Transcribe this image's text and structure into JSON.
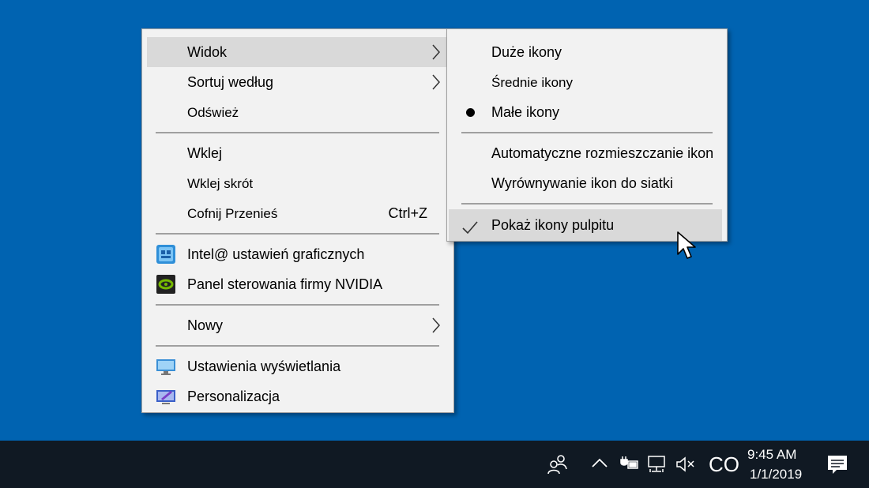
{
  "main_menu": {
    "items": [
      {
        "label": "Widok",
        "has_submenu": true,
        "highlighted": true
      },
      {
        "label": "Sortuj według",
        "has_submenu": true
      },
      {
        "label": "Odśwież"
      },
      {
        "label": "Wklej"
      },
      {
        "label": "Wklej skrót"
      },
      {
        "label": "Cofnij Przenieś",
        "shortcut": "Ctrl+Z"
      },
      {
        "label": "Intel@ ustawień graficznych",
        "icon": "intel-graphics-icon"
      },
      {
        "label": "Panel sterowania firmy NVIDIA",
        "icon": "nvidia-icon"
      },
      {
        "label": "Nowy",
        "has_submenu": true
      },
      {
        "label": "Ustawienia wyświetlania",
        "icon": "display-icon"
      },
      {
        "label": "Personalizacja",
        "icon": "personalize-icon"
      }
    ]
  },
  "view_submenu": {
    "items": [
      {
        "label": "Duże ikony"
      },
      {
        "label": "Średnie ikony"
      },
      {
        "label": "Małe ikony",
        "marker": "bullet"
      },
      {
        "label": "Automatyczne rozmieszczanie ikon"
      },
      {
        "label": "Wyrównywanie ikon do siatki"
      },
      {
        "label": "Pokaż ikony pulpitu",
        "marker": "check",
        "highlighted": true
      }
    ]
  },
  "taskbar": {
    "ime_indicator": "CO",
    "clock_time": "9:45 AM",
    "clock_date": "1/1/2019",
    "tray_icons": [
      "people-icon",
      "chevron-up-icon",
      "power-icon",
      "network-icon",
      "volume-muted-icon",
      "notification-icon"
    ]
  },
  "colors": {
    "desktop": "#0063b1",
    "menu_bg": "#f2f2f2",
    "highlight": "#d9d9d9",
    "taskbar": "#101923"
  }
}
